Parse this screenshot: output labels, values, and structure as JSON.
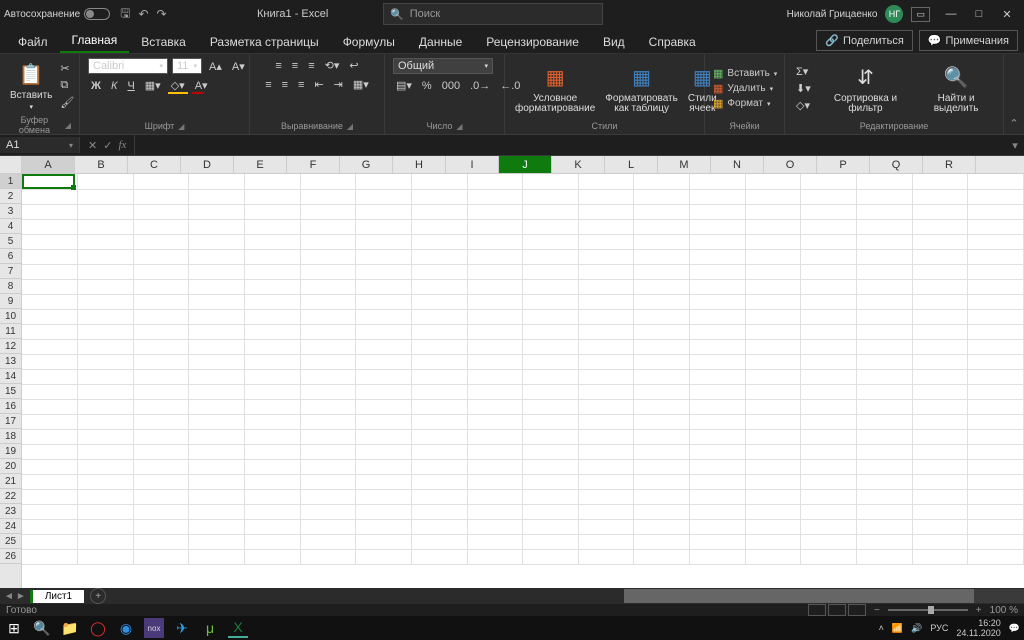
{
  "titlebar": {
    "autosave_label": "Автосохранение",
    "doc_title": "Книга1  -  Excel",
    "search_placeholder": "Поиск",
    "user_name": "Николай Грицаенко",
    "user_initials": "НГ"
  },
  "tabs": {
    "file": "Файл",
    "home": "Главная",
    "insert": "Вставка",
    "layout": "Разметка страницы",
    "formulas": "Формулы",
    "data": "Данные",
    "review": "Рецензирование",
    "view": "Вид",
    "help": "Справка",
    "share": "Поделиться",
    "comments": "Примечания"
  },
  "ribbon": {
    "clipboard": {
      "paste": "Вставить",
      "label": "Буфер обмена"
    },
    "font": {
      "name": "Calibri",
      "size": "11",
      "bold": "Ж",
      "italic": "К",
      "underline": "Ч",
      "label": "Шрифт"
    },
    "alignment": {
      "label": "Выравнивание"
    },
    "number": {
      "format": "Общий",
      "label": "Число"
    },
    "styles": {
      "conditional": "Условное форматирование",
      "table": "Форматировать как таблицу",
      "cell": "Стили ячеек",
      "label": "Стили"
    },
    "cells": {
      "insert": "Вставить",
      "delete": "Удалить",
      "format": "Формат",
      "label": "Ячейки"
    },
    "editing": {
      "sort": "Сортировка и фильтр",
      "find": "Найти и выделить",
      "label": "Редактирование"
    }
  },
  "formula_bar": {
    "name_box": "A1",
    "fx": "fx"
  },
  "grid": {
    "columns": [
      "A",
      "B",
      "C",
      "D",
      "E",
      "F",
      "G",
      "H",
      "I",
      "J",
      "K",
      "L",
      "M",
      "N",
      "O",
      "P",
      "Q",
      "R"
    ],
    "rows": [
      "1",
      "2",
      "3",
      "4",
      "5",
      "6",
      "7",
      "8",
      "9",
      "10",
      "11",
      "12",
      "13",
      "14",
      "15",
      "16",
      "17",
      "18",
      "19",
      "20",
      "21",
      "22",
      "23",
      "24",
      "25",
      "26"
    ],
    "active_cell": "A1",
    "highlighted_column": "J"
  },
  "sheets": {
    "sheet1": "Лист1"
  },
  "status": {
    "ready": "Готово",
    "zoom": "100 %"
  },
  "taskbar": {
    "lang": "РУС",
    "time": "16:20",
    "date": "24.11.2020"
  }
}
